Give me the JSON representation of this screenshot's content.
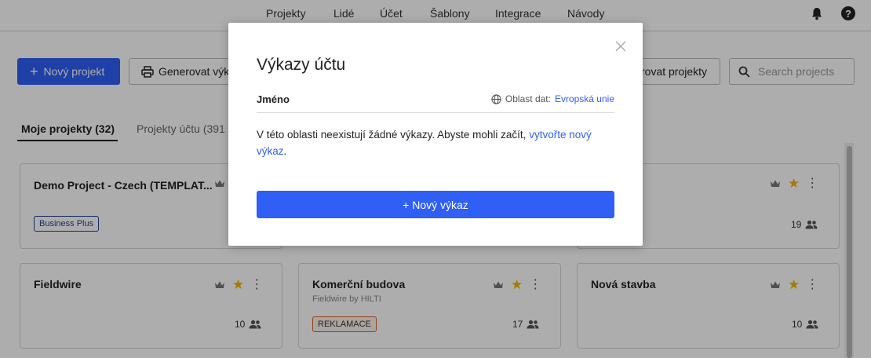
{
  "topnav": {
    "items": [
      "Projekty",
      "Lidé",
      "Účet",
      "Šablony",
      "Integrace",
      "Návody"
    ],
    "help_label": "?"
  },
  "toolbar": {
    "new_project": "Nový projekt",
    "generate_reports_partial": "Generovat výk",
    "generate_projects_partial": "rovat projekty",
    "search_placeholder": "Search projects"
  },
  "tabs": {
    "my_projects": "Moje projekty (32)",
    "account_projects": "Projekty účtu (391"
  },
  "cards": [
    {
      "title": "Demo Project - Czech (TEMPLAT...",
      "tag": "Business Plus",
      "count": ""
    },
    {
      "title": "",
      "tag": "",
      "count": "19"
    },
    {
      "title": "Fieldwire",
      "subtitle": "",
      "tag": "",
      "count": "10"
    },
    {
      "title": "Komerční budova",
      "subtitle": "Fieldwire by HILTI",
      "tag": "REKLAMACE",
      "count": "17"
    },
    {
      "title": "Nová stavba",
      "subtitle": "",
      "tag": "",
      "count": "10"
    }
  ],
  "modal": {
    "title": "Výkazy účtu",
    "column_name": "Jméno",
    "region_label": "Oblast dat:",
    "region_value": "Evropská unie",
    "empty_text": "V této oblasti neexistují žádné výkazy. Abyste mohli začít,",
    "empty_link": "vytvořte nový výkaz",
    "empty_end": ".",
    "new_report_button": "+ Nový výkaz"
  },
  "colors": {
    "accent": "#2f5ff5",
    "star": "#f2b400",
    "tag_business": "#2b3f8f",
    "tag_reklamace": "#d9662b"
  }
}
